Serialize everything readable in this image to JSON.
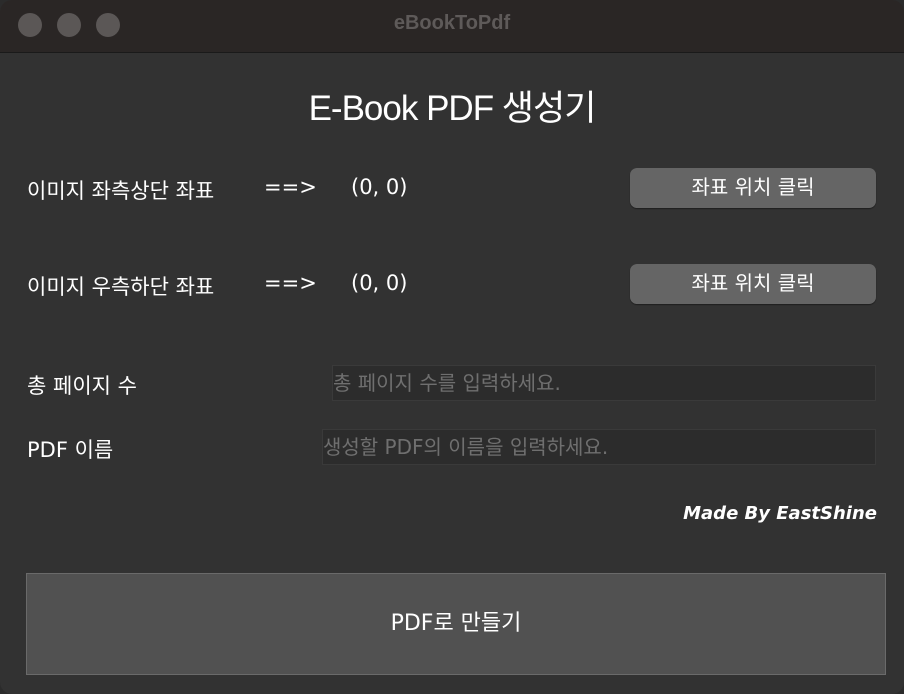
{
  "window": {
    "title": "eBookToPdf"
  },
  "header": {
    "title": "E-Book PDF 생성기"
  },
  "top_left": {
    "label": "이미지 좌측상단 좌표",
    "arrow": "==>",
    "value": "(0, 0)",
    "button": "좌표 위치 클릭"
  },
  "bottom_right": {
    "label": "이미지 우측하단 좌표",
    "arrow": "==>",
    "value": "(0, 0)",
    "button": "좌표 위치 클릭"
  },
  "total_pages": {
    "label": "총 페이지 수",
    "placeholder": "총 페이지 수를 입력하세요."
  },
  "pdf_name": {
    "label": "PDF 이름",
    "placeholder": "생성할 PDF의 이름을 입력하세요."
  },
  "credit": "Made By EastShine",
  "make_button": "PDF로 만들기"
}
